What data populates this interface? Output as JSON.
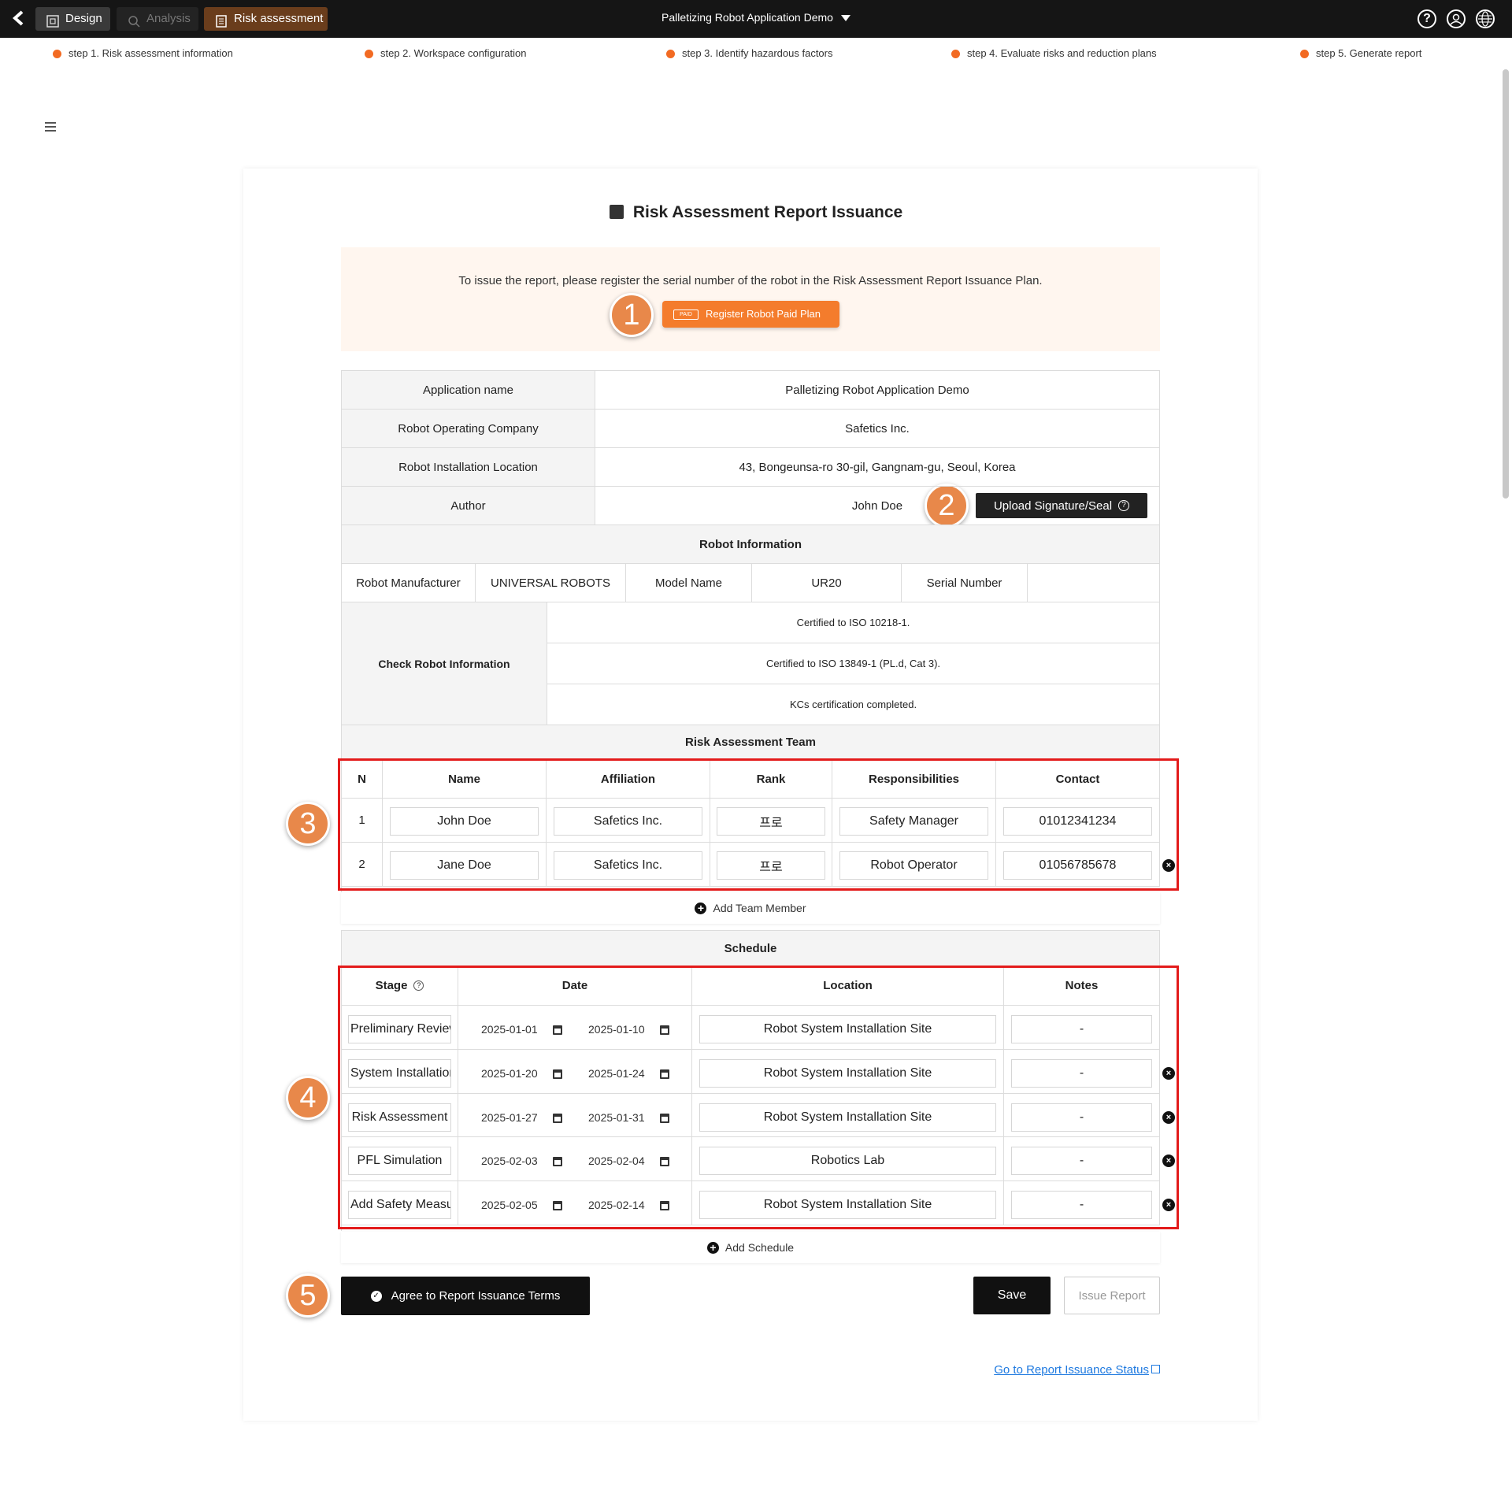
{
  "topbar": {
    "tabs": [
      "Design",
      "Analysis",
      "Risk assessment"
    ],
    "app_title": "Palletizing Robot Application Demo"
  },
  "steps": [
    "step 1. Risk assessment information",
    "step 2. Workspace configuration",
    "step 3. Identify hazardous factors",
    "step 4. Evaluate risks and reduction plans",
    "step 5. Generate report"
  ],
  "page_title": "Risk Assessment Report Issuance",
  "notice": {
    "text": "To issue the report, please register the serial number of the robot in the Risk Assessment Report Issuance Plan.",
    "button": "Register Robot Paid Plan",
    "tag": "PAID"
  },
  "badges": [
    "1",
    "2",
    "3",
    "4",
    "5"
  ],
  "info": {
    "rows": [
      {
        "label": "Application name",
        "value": "Palletizing Robot Application Demo"
      },
      {
        "label": "Robot Operating Company",
        "value": "Safetics Inc."
      },
      {
        "label": "Robot Installation Location",
        "value": "43, Bongeunsa-ro 30-gil, Gangnam-gu, Seoul, Korea"
      },
      {
        "label": "Author",
        "value": "John Doe"
      }
    ],
    "upload_button": "Upload Signature/Seal"
  },
  "robot_info": {
    "header": "Robot Information",
    "manufacturer_label": "Robot Manufacturer",
    "manufacturer": "UNIVERSAL ROBOTS",
    "model_label": "Model Name",
    "model": "UR20",
    "serial_label": "Serial Number",
    "serial": "",
    "check_label": "Check Robot Information",
    "checks": [
      "Certified to ISO 10218-1.",
      "Certified to ISO 13849-1 (PL.d, Cat 3).",
      "KCs certification completed."
    ]
  },
  "team": {
    "header": "Risk Assessment Team",
    "columns": [
      "N",
      "Name",
      "Affiliation",
      "Rank",
      "Responsibilities",
      "Contact"
    ],
    "rows": [
      {
        "n": "1",
        "name": "John Doe",
        "affiliation": "Safetics Inc.",
        "rank": "프로",
        "resp": "Safety Manager",
        "contact": "01012341234"
      },
      {
        "n": "2",
        "name": "Jane Doe",
        "affiliation": "Safetics Inc.",
        "rank": "프로",
        "resp": "Robot Operator",
        "contact": "01056785678"
      }
    ],
    "add_label": "Add Team Member"
  },
  "schedule": {
    "header": "Schedule",
    "columns": [
      "Stage",
      "Date",
      "Location",
      "Notes"
    ],
    "rows": [
      {
        "stage": "Preliminary Review",
        "start": "2025-01-01",
        "end": "2025-01-10",
        "location": "Robot System Installation Site",
        "notes": "-"
      },
      {
        "stage": "System Installation",
        "start": "2025-01-20",
        "end": "2025-01-24",
        "location": "Robot System Installation Site",
        "notes": "-"
      },
      {
        "stage": "Risk Assessment",
        "start": "2025-01-27",
        "end": "2025-01-31",
        "location": "Robot System Installation Site",
        "notes": "-"
      },
      {
        "stage": "PFL Simulation",
        "start": "2025-02-03",
        "end": "2025-02-04",
        "location": "Robotics Lab",
        "notes": "-"
      },
      {
        "stage": "Add Safety Measures",
        "start": "2025-02-05",
        "end": "2025-02-14",
        "location": "Robot System Installation Site",
        "notes": "-"
      }
    ],
    "add_label": "Add Schedule"
  },
  "actions": {
    "agree": "Agree to Report Issuance Terms",
    "save": "Save",
    "issue": "Issue Report",
    "go_status": "Go to Report Issuance Status"
  }
}
